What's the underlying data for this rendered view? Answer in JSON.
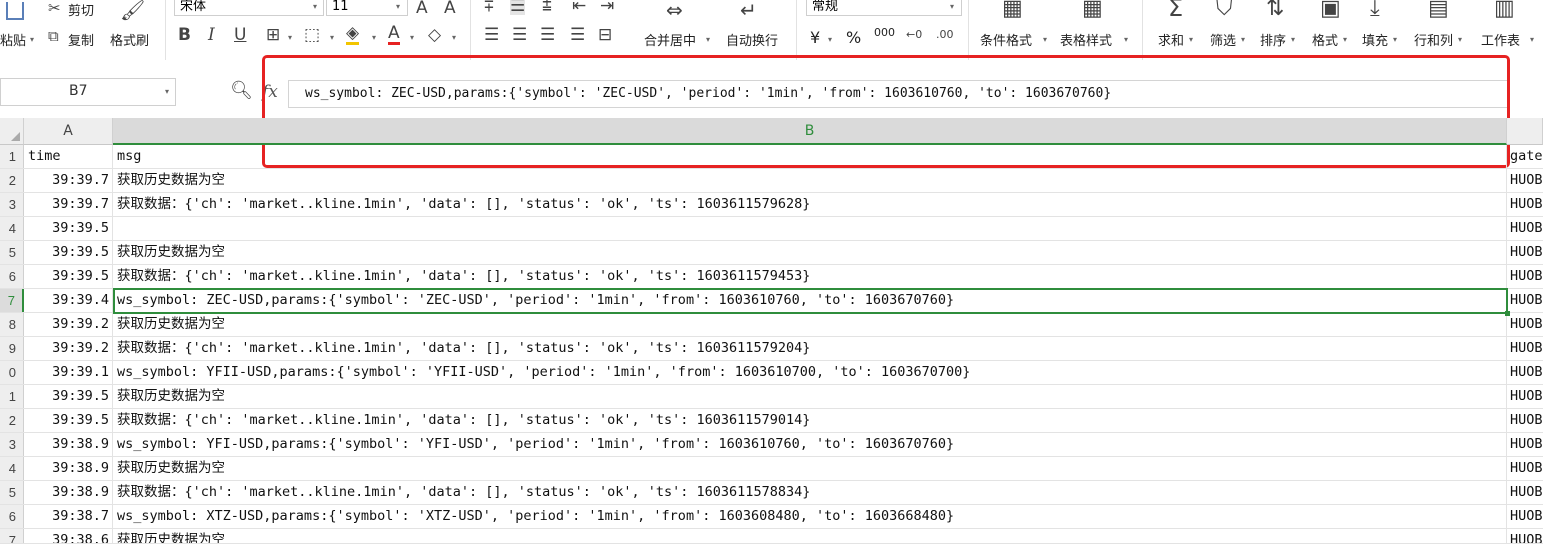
{
  "toolbar": {
    "paste_label": "粘贴",
    "cut_label": "剪切",
    "copy_label": "复制",
    "format_painter_label": "格式刷",
    "font_name": "宋体",
    "font_size": "11",
    "number_format": "常规",
    "merge_center_label": "合并居中",
    "wrap_text_label": "自动换行",
    "currency_symbol": "¥",
    "percent_symbol": "%",
    "thousands_symbol": "000",
    "cond_format_label": "条件格式",
    "table_style_label": "表格样式",
    "sum_label": "求和",
    "filter_label": "筛选",
    "sort_label": "排序",
    "format_label": "格式",
    "fill_label": "填充",
    "rowcol_label": "行和列",
    "sheet_label": "工作表"
  },
  "formula_bar": {
    "name_box": "B7",
    "fx_label": "fx",
    "content": "ws_symbol: ZEC-USD,params:{'symbol': 'ZEC-USD', 'period': '1min', 'from': 1603610760, 'to': 1603670760}"
  },
  "columns": {
    "a": "A",
    "b": "B"
  },
  "colors": {
    "highlight": "#e62222",
    "selection": "#2f8d3c"
  },
  "rows": [
    {
      "num": "1",
      "time": "time",
      "msg": "msg",
      "c": "gate"
    },
    {
      "num": "2",
      "time": "39:39.7",
      "msg": "获取历史数据为空",
      "c": "HUOB"
    },
    {
      "num": "3",
      "time": "39:39.7",
      "msg": "获取数据：{'ch': 'market..kline.1min', 'data': [], 'status': 'ok', 'ts': 1603611579628}",
      "c": "HUOB"
    },
    {
      "num": "4",
      "time": "39:39.5",
      "msg": "",
      "c": "HUOB"
    },
    {
      "num": "5",
      "time": "39:39.5",
      "msg": "获取历史数据为空",
      "c": "HUOB"
    },
    {
      "num": "6",
      "time": "39:39.5",
      "msg": "获取数据：{'ch': 'market..kline.1min', 'data': [], 'status': 'ok', 'ts': 1603611579453}",
      "c": "HUOB"
    },
    {
      "num": "7",
      "time": "39:39.4",
      "msg": "ws_symbol: ZEC-USD,params:{'symbol': 'ZEC-USD', 'period': '1min', 'from': 1603610760, 'to': 1603670760}",
      "c": "HUOB"
    },
    {
      "num": "8",
      "time": "39:39.2",
      "msg": "获取历史数据为空",
      "c": "HUOB"
    },
    {
      "num": "9",
      "time": "39:39.2",
      "msg": "获取数据：{'ch': 'market..kline.1min', 'data': [], 'status': 'ok', 'ts': 1603611579204}",
      "c": "HUOB"
    },
    {
      "num": "0",
      "time": "39:39.1",
      "msg": "ws_symbol: YFII-USD,params:{'symbol': 'YFII-USD', 'period': '1min', 'from': 1603610700, 'to': 1603670700}",
      "c": "HUOB"
    },
    {
      "num": "1",
      "time": "39:39.5",
      "msg": "获取历史数据为空",
      "c": "HUOB"
    },
    {
      "num": "2",
      "time": "39:39.5",
      "msg": "获取数据：{'ch': 'market..kline.1min', 'data': [], 'status': 'ok', 'ts': 1603611579014}",
      "c": "HUOB"
    },
    {
      "num": "3",
      "time": "39:38.9",
      "msg": "ws_symbol: YFI-USD,params:{'symbol': 'YFI-USD', 'period': '1min', 'from': 1603610760, 'to': 1603670760}",
      "c": "HUOB"
    },
    {
      "num": "4",
      "time": "39:38.9",
      "msg": "获取历史数据为空",
      "c": "HUOB"
    },
    {
      "num": "5",
      "time": "39:38.9",
      "msg": "获取数据：{'ch': 'market..kline.1min', 'data': [], 'status': 'ok', 'ts': 1603611578834}",
      "c": "HUOB"
    },
    {
      "num": "6",
      "time": "39:38.7",
      "msg": "ws_symbol: XTZ-USD,params:{'symbol': 'XTZ-USD', 'period': '1min', 'from': 1603608480, 'to': 1603668480}",
      "c": "HUOB"
    },
    {
      "num": "7",
      "time": "39:38.6",
      "msg": "获取历史数据为空",
      "c": "HUOB"
    }
  ]
}
